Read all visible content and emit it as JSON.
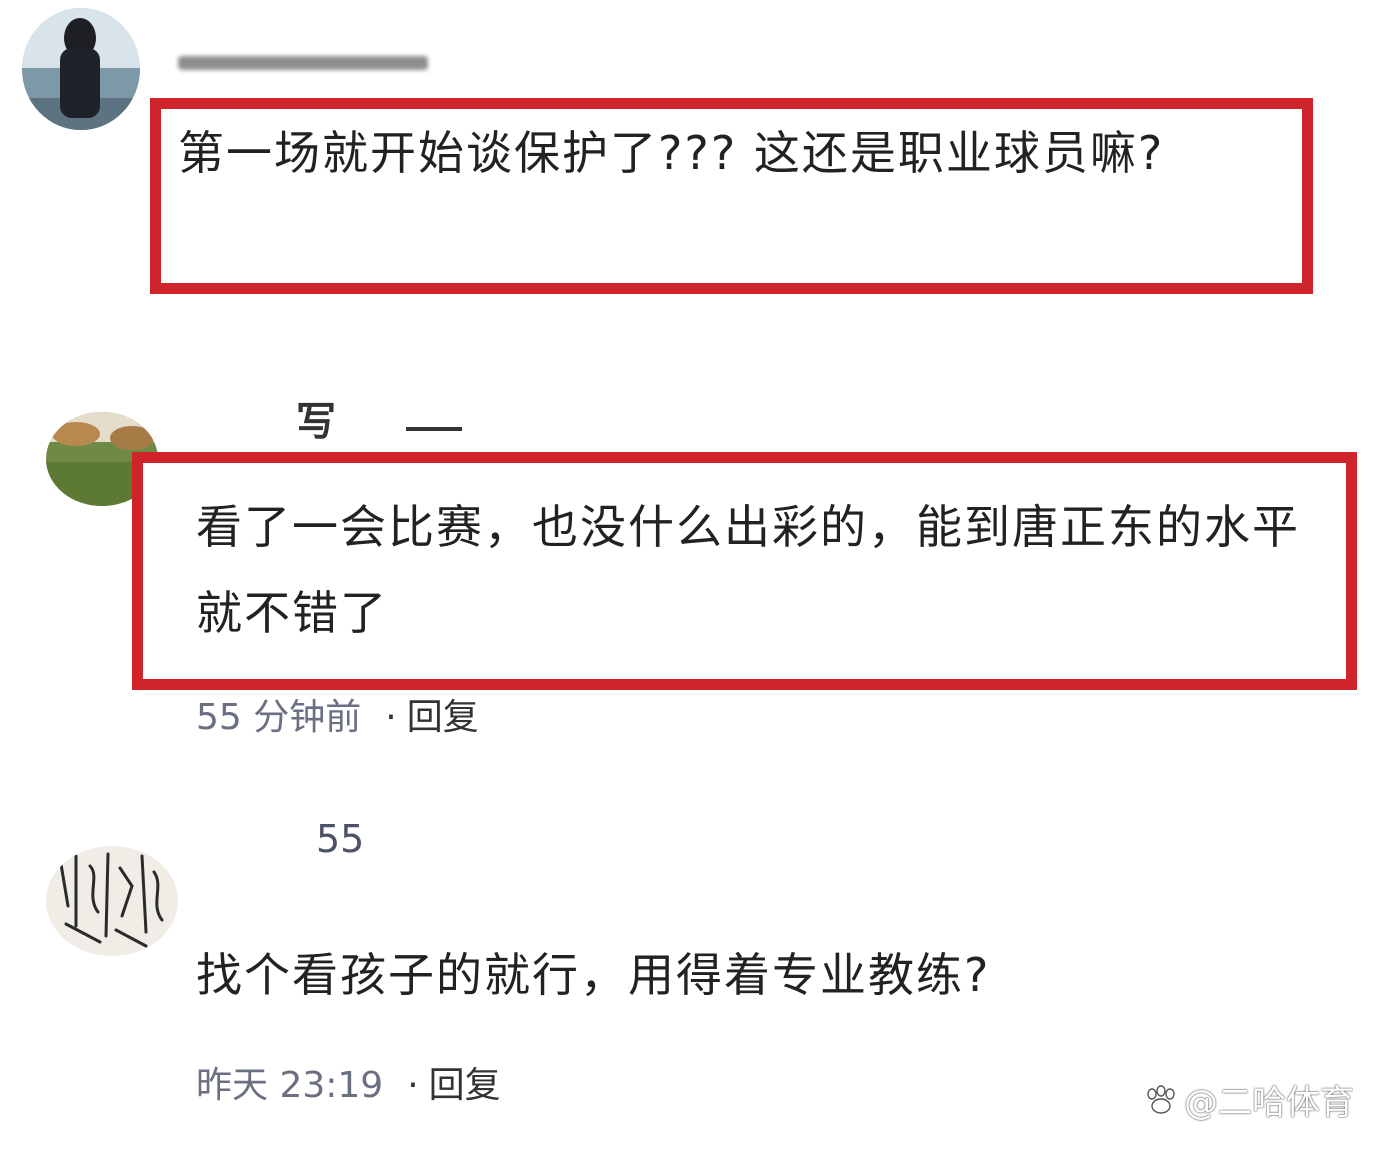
{
  "comments": [
    {
      "username": "",
      "text": "第一场就开始谈保护了???  这还是职业球员嘛?",
      "time": "",
      "reply_label": ""
    },
    {
      "username": "写",
      "text": "看了一会比赛，也没什么出彩的，能到唐正东的水平就不错了",
      "time": "55 分钟前",
      "reply_label": "回复"
    },
    {
      "username": "55",
      "text": "找个看孩子的就行，用得着专业教练?",
      "time": "昨天 23:19",
      "reply_label": "回复"
    }
  ],
  "meta_separator": "·",
  "watermark": {
    "text": "@二哈体育",
    "icon": "paw-icon"
  },
  "colors": {
    "highlight_border": "#d0242c",
    "meta_text": "#6a6f82",
    "body_text": "#222222"
  }
}
